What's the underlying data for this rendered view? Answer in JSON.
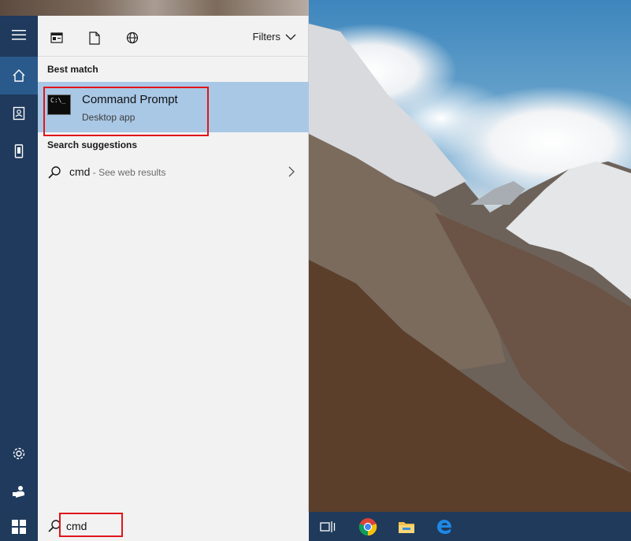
{
  "panel": {
    "filters_label": "Filters",
    "best_match_heading": "Best match",
    "best_match": {
      "title": "Command Prompt",
      "subtitle": "Desktop app",
      "icon_text": "C:\\_"
    },
    "suggestions_heading": "Search suggestions",
    "suggestion": {
      "query": "cmd",
      "hint": " - See web results"
    }
  },
  "taskbar": {
    "search_value": "cmd"
  },
  "icons": {
    "rail": [
      "hamburger-icon",
      "home-icon",
      "notebook-icon",
      "device-icon",
      "settings-icon",
      "feedback-icon"
    ],
    "toolbar": [
      "apps-icon",
      "documents-icon",
      "web-icon"
    ],
    "taskbar": [
      "windows-icon",
      "search-icon",
      "task-view-icon",
      "chrome-icon",
      "file-explorer-icon",
      "edge-icon"
    ]
  },
  "colors": {
    "rail": "#1f3a5c",
    "rail_active": "#2a5a8c",
    "highlight": "#a9c8e6",
    "annotation": "#e0141a",
    "taskbar": "#203a5b"
  }
}
